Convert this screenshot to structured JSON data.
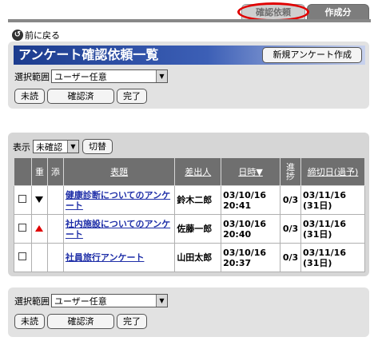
{
  "tabs": {
    "confirm": "確認依頼",
    "created": "作成分"
  },
  "back_label": "前に戻る",
  "title": "アンケート確認依頼一覧",
  "new_survey_label": "新規アンケート作成",
  "scope": {
    "label": "選択範囲",
    "value": "ユーザー任意"
  },
  "filter_buttons": {
    "unread": "未読",
    "confirmed": "確認済",
    "done": "完了"
  },
  "display": {
    "label": "表示",
    "value": "未確認",
    "switch_label": "切替"
  },
  "table": {
    "headers": {
      "priority": "重",
      "attachment": "添",
      "subject": "表題",
      "sender": "差出人",
      "datetime": "日時▼",
      "progress": "進捗",
      "deadline": "締切日(過予)"
    },
    "rows": [
      {
        "priority": "down",
        "subject": "健康診断についてのアンケート",
        "sender": "鈴木二郎",
        "datetime": "03/10/16 20:41",
        "progress": "0/3",
        "deadline": "03/11/16 (31日)"
      },
      {
        "priority": "up",
        "subject": "社内施設についてのアンケート",
        "sender": "佐藤一郎",
        "datetime": "03/10/16 20:40",
        "progress": "0/3",
        "deadline": "03/11/16 (31日)"
      },
      {
        "priority": "",
        "subject": "社員旅行アンケート",
        "sender": "山田太郎",
        "datetime": "03/10/16 20:37",
        "progress": "0/3",
        "deadline": "03/11/16 (31日)"
      }
    ]
  },
  "colors": {
    "accent": "#1c3c8e",
    "highlight": "#e00000",
    "link": "#1f2fa8"
  }
}
